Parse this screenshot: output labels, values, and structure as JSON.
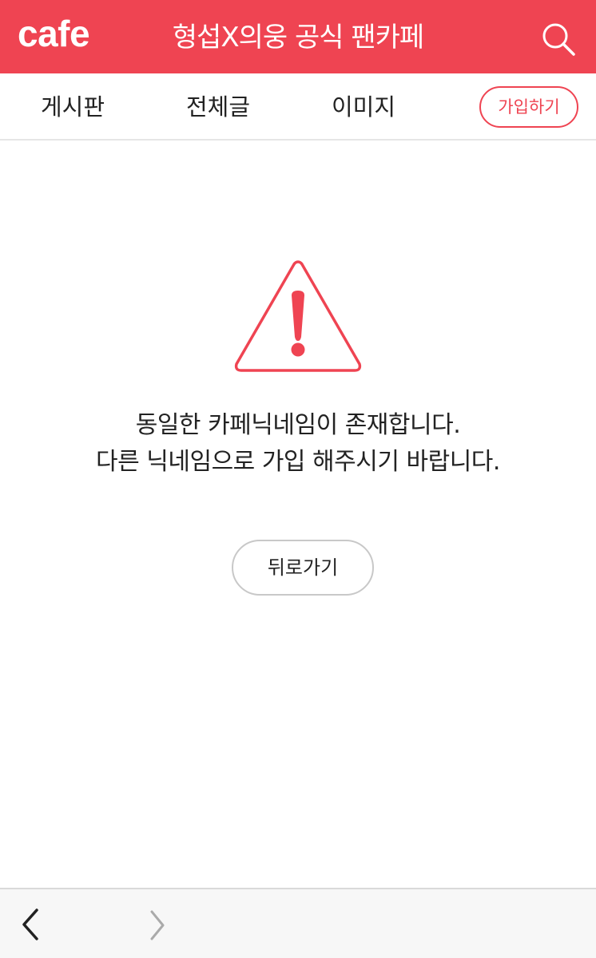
{
  "header": {
    "logo": "cafe",
    "title": "형섭X의웅 공식 팬카페",
    "search_icon": "search-icon",
    "background_color": "#ef4452"
  },
  "nav": {
    "tabs": [
      {
        "label": "게시판"
      },
      {
        "label": "전체글"
      },
      {
        "label": "이미지"
      }
    ],
    "join_label": "가입하기"
  },
  "alert": {
    "icon": "warning-icon",
    "icon_color": "#ef4452",
    "lines": [
      "동일한 카페닉네임이 존재합니다.",
      "다른 닉네임으로 가입 해주시기 바랍니다."
    ],
    "back_label": "뒤로가기"
  },
  "browser_bar": {
    "back_icon": "chevron-left-icon",
    "forward_icon": "chevron-right-icon"
  }
}
